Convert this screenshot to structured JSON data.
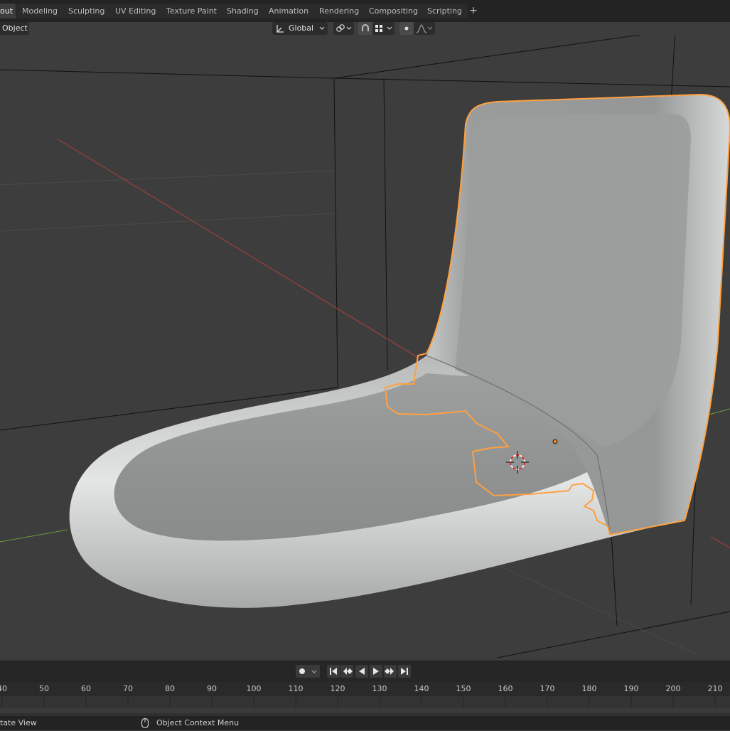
{
  "workspaces": {
    "tabs": [
      {
        "label": "out",
        "active": true
      },
      {
        "label": "Modeling"
      },
      {
        "label": "Sculpting"
      },
      {
        "label": "UV Editing"
      },
      {
        "label": "Texture Paint"
      },
      {
        "label": "Shading"
      },
      {
        "label": "Animation"
      },
      {
        "label": "Rendering"
      },
      {
        "label": "Compositing"
      },
      {
        "label": "Scripting"
      }
    ],
    "add_label": "+"
  },
  "header": {
    "menu_object": "Object",
    "transform_orientation": "Global",
    "icons": [
      "orientation-icon",
      "snap-link-icon",
      "snapping-icon",
      "snap-grid-icon",
      "proportional-dot-icon",
      "falloff-curve-icon"
    ]
  },
  "timeline": {
    "frame_ticks": [
      "40",
      "50",
      "60",
      "70",
      "80",
      "90",
      "100",
      "110",
      "120",
      "130",
      "140",
      "150",
      "160",
      "170",
      "180",
      "190",
      "200",
      "210"
    ],
    "playback_icons": [
      "record-icon",
      "jump-start-icon",
      "prev-keyframe-icon",
      "play-reverse-icon",
      "play-icon",
      "next-keyframe-icon",
      "jump-end-icon"
    ]
  },
  "status": {
    "left_label": "tate View",
    "mid_label": "Object Context Menu"
  },
  "colors": {
    "selection_outline": "#ffa040",
    "viewport_bg": "#3d3d3d",
    "x_axis": "#b0403c",
    "y_axis": "#6c9a3a"
  }
}
